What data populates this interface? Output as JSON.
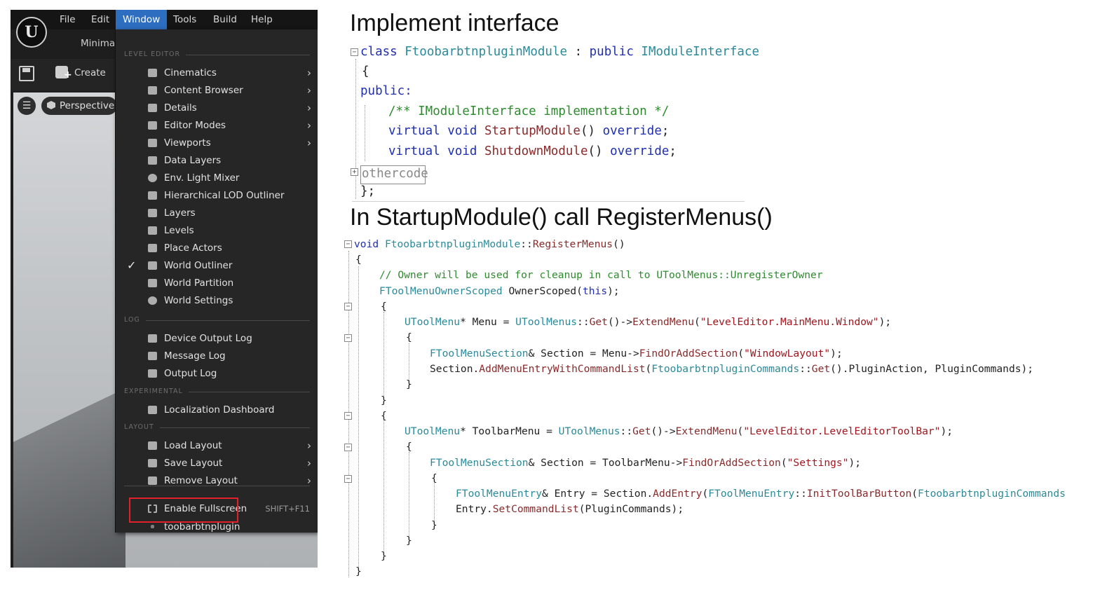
{
  "editor": {
    "logo": "U",
    "menubar": {
      "items": [
        "File",
        "Edit",
        "Window",
        "Tools",
        "Build",
        "Help"
      ],
      "active": "Window"
    },
    "minimal_tab": "Minimal",
    "toolbar": {
      "create_label": "Create"
    },
    "viewport": {
      "perspective_label": "Perspective"
    },
    "window_menu": {
      "sections": {
        "level_editor": "LEVEL EDITOR",
        "log": "LOG",
        "experimental": "EXPERIMENTAL",
        "layout": "LAYOUT"
      },
      "items": {
        "cinematics": "Cinematics",
        "content_browser": "Content Browser",
        "details": "Details",
        "editor_modes": "Editor Modes",
        "viewports": "Viewports",
        "data_layers": "Data Layers",
        "env_light_mixer": "Env. Light Mixer",
        "hlod_outliner": "Hierarchical LOD Outliner",
        "layers": "Layers",
        "levels": "Levels",
        "place_actors": "Place Actors",
        "world_outliner": "World Outliner",
        "world_partition": "World Partition",
        "world_settings": "World Settings",
        "device_output_log": "Device Output Log",
        "message_log": "Message Log",
        "output_log": "Output Log",
        "localization_dashboard": "Localization Dashboard",
        "load_layout": "Load Layout",
        "save_layout": "Save Layout",
        "remove_layout": "Remove Layout",
        "enable_fullscreen": "Enable Fullscreen",
        "enable_fullscreen_shortcut": "SHIFT+F11",
        "plugin": "toobarbtnplugin"
      },
      "checked_item": "World Outliner"
    }
  },
  "slide": {
    "heading1": "Implement interface",
    "heading2": "In StartupModule()  call RegisterMenus()",
    "code1": {
      "l1": {
        "kw": "class",
        "name": "FtoobarbtnpluginModule",
        "mid": " : ",
        "kw2": "public",
        "iface": "IModuleInterface"
      },
      "l2": "{",
      "l3": "public:",
      "l4": "/** IModuleInterface implementation */",
      "l5": {
        "kw": "virtual void",
        "fn": "StartupModule",
        "rest": "()",
        "ov": "override",
        "end": ";"
      },
      "l6": {
        "kw": "virtual void",
        "fn": "ShutdownModule",
        "rest": "()",
        "ov": "override",
        "end": ";"
      },
      "l7": "othercode",
      "l8": "};"
    },
    "code2": {
      "l1": {
        "kw": "void",
        "cls": "FtoobarbtnpluginModule",
        "sep": "::",
        "fn": "RegisterMenus",
        "rest": "()"
      },
      "l2": "{",
      "l3": "// Owner will be used for cleanup in call to UToolMenus::UnregisterOwner",
      "l4": {
        "type": "FToolMenuOwnerScoped",
        "var": " OwnerScoped(",
        "kw": "this",
        "end": ");"
      },
      "l5": "{",
      "l6": {
        "type": "UToolMenu",
        "a": "* Menu = ",
        "cls": "UToolMenus",
        "b": "::",
        "fn1": "Get",
        "c": "()->",
        "fn2": "ExtendMenu",
        "d": "(",
        "str": "\"LevelEditor.MainMenu.Window\"",
        "e": ");"
      },
      "l7": "{",
      "l8": {
        "type": "FToolMenuSection",
        "a": "& Section = Menu->",
        "fn": "FindOrAddSection",
        "b": "(",
        "str": "\"WindowLayout\"",
        "c": ");"
      },
      "l9": {
        "a": "Section.",
        "fn": "AddMenuEntryWithCommandList",
        "b": "(",
        "cls": "FtoobarbtnpluginCommands",
        "c": "::",
        "fn2": "Get",
        "d": "().PluginAction, PluginCommands);"
      },
      "l10": "}",
      "l11": "}",
      "l12": "{",
      "l13": {
        "type": "UToolMenu",
        "a": "* ToolbarMenu = ",
        "cls": "UToolMenus",
        "b": "::",
        "fn1": "Get",
        "c": "()->",
        "fn2": "ExtendMenu",
        "d": "(",
        "str": "\"LevelEditor.LevelEditorToolBar\"",
        "e": ");"
      },
      "l14": "{",
      "l15": {
        "type": "FToolMenuSection",
        "a": "& Section = ToolbarMenu->",
        "fn": "FindOrAddSection",
        "b": "(",
        "str": "\"Settings\"",
        "c": ");"
      },
      "l16": "{",
      "l17": {
        "type": "FToolMenuEntry",
        "a": "& Entry = Section.",
        "fn": "AddEntry",
        "b": "(",
        "cls": "FToolMenuEntry",
        "c": "::",
        "fn2": "InitToolBarButton",
        "d": "(",
        "cls2": "FtoobarbtnpluginCommands"
      },
      "l18": {
        "a": "Entry.",
        "fn": "SetCommandList",
        "b": "(PluginCommands);"
      },
      "l19": "}",
      "l20": "}",
      "l21": "}",
      "l22": "}"
    }
  }
}
